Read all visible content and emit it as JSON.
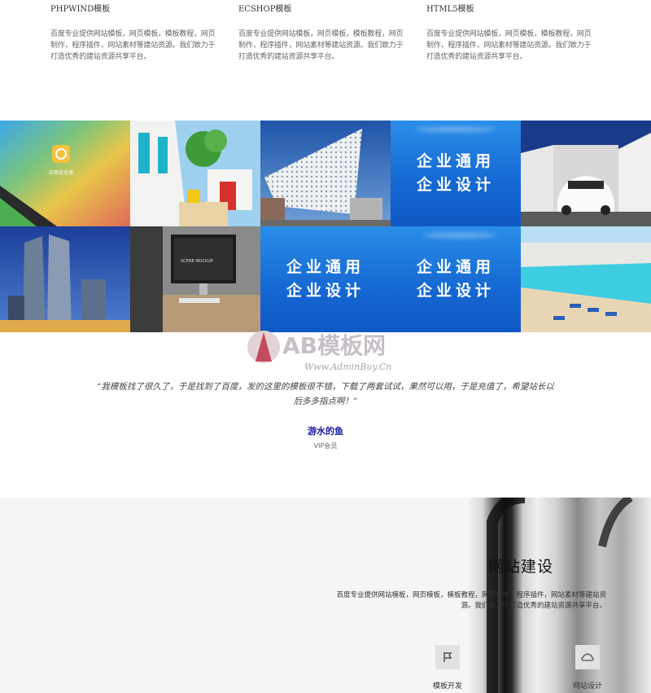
{
  "features": [
    {
      "title": "PHPWIND模板",
      "desc": "百度专业提供网站模板，网页模板，模板教程，网页制作，程序插件，网站素材等建站资源。我们致力于打造优秀的建站资源共享平台。"
    },
    {
      "title": "ECSHOP模板",
      "desc": "百度专业提供网站模板，网页模板，模板教程，网页制作，程序插件，网站素材等建站资源。我们致力于打造优秀的建站资源共享平台。"
    },
    {
      "title": "HTML5模板",
      "desc": "百度专业提供网站模板，网页模板，模板教程，网页制作，程序插件，网站素材等建站资源。我们致力于打造优秀的建站资源共享平台。"
    }
  ],
  "gallery": {
    "ad_line1": "企业通用",
    "ad_line2": "企业设计",
    "app_label": "应用安全锁"
  },
  "watermark": {
    "brand": "AB模板网",
    "url": "Www.AdminBuy.Cn"
  },
  "testimonial": {
    "quote": "“我模板找了很久了，于是找到了百度，发的这里的模板很不错，下载了两套试试，果然可以用，于是充值了，希望站长以后多多指点啊！”",
    "author": "游水的鱼",
    "role": "VIP会员"
  },
  "service": {
    "title": "网站建设",
    "desc": "百度专业提供网站模板，网页模板，模板教程，网页制作，程序插件，网站素材等建站资源。我们致力于打造优秀的建站资源共享平台。",
    "items": [
      {
        "label": "模板开发",
        "icon": "flag-icon"
      },
      {
        "label": "网站设计",
        "icon": "cloud-icon"
      }
    ]
  }
}
